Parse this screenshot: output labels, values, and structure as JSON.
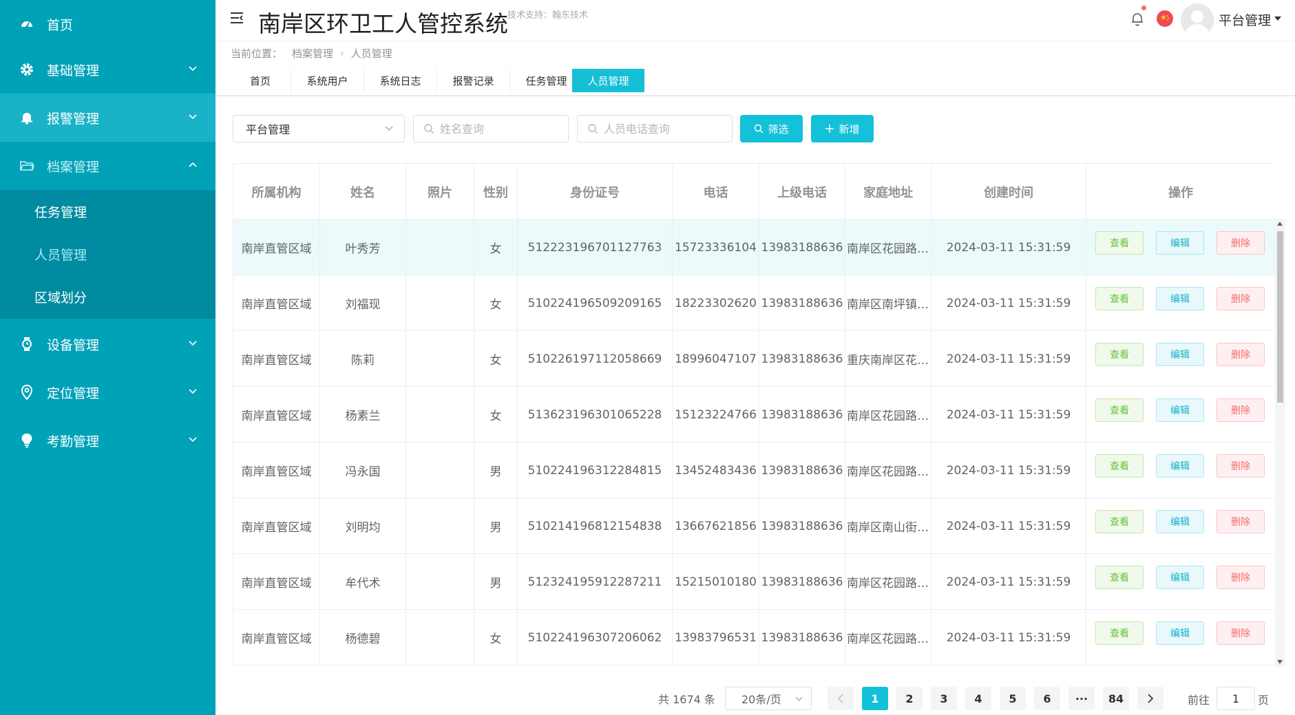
{
  "sidebar": {
    "items": [
      {
        "label": "首页",
        "icon": "dashboard-icon"
      },
      {
        "label": "基础管理",
        "icon": "gear-icon"
      },
      {
        "label": "报警管理",
        "icon": "bell-icon"
      },
      {
        "label": "档案管理",
        "icon": "folder-icon"
      },
      {
        "label": "设备管理",
        "icon": "watch-icon"
      },
      {
        "label": "定位管理",
        "icon": "location-icon"
      },
      {
        "label": "考勤管理",
        "icon": "bulb-icon"
      }
    ],
    "sub_items": [
      {
        "label": "任务管理"
      },
      {
        "label": "人员管理"
      },
      {
        "label": "区域划分"
      }
    ]
  },
  "header": {
    "title": "南岸区环卫工人管控系统",
    "tech_support": "技术支持：翰东技术",
    "user_name": "平台管理"
  },
  "breadcrumb": {
    "prefix": "当前位置：",
    "items": [
      "档案管理",
      "人员管理"
    ]
  },
  "tabs": [
    {
      "label": "首页"
    },
    {
      "label": "系统用户"
    },
    {
      "label": "系统日志"
    },
    {
      "label": "报警记录"
    },
    {
      "label": "任务管理"
    },
    {
      "label": "人员管理"
    }
  ],
  "filters": {
    "org_select": "平台管理",
    "name_placeholder": "姓名查询",
    "phone_placeholder": "人员电话查询",
    "filter_btn": "筛选",
    "add_btn": "新增"
  },
  "table": {
    "columns": [
      "所属机构",
      "姓名",
      "照片",
      "性别",
      "身份证号",
      "电话",
      "上级电话",
      "家庭地址",
      "创建时间",
      "操作"
    ],
    "op_labels": {
      "view": "查看",
      "edit": "编辑",
      "delete": "删除"
    },
    "rows": [
      {
        "org": "南岸直管区域",
        "name": "叶秀芳",
        "gender": "女",
        "id": "512223196701127763",
        "phone": "15723336104",
        "sup_phone": "13983188636",
        "addr": "南岸区花园路…",
        "created": "2024-03-11 15:31:59"
      },
      {
        "org": "南岸直管区域",
        "name": "刘福现",
        "gender": "女",
        "id": "510224196509209165",
        "phone": "18223302620",
        "sup_phone": "13983188636",
        "addr": "南岸区南坪镇…",
        "created": "2024-03-11 15:31:59"
      },
      {
        "org": "南岸直管区域",
        "name": "陈莉",
        "gender": "女",
        "id": "510226197112058669",
        "phone": "18996047107",
        "sup_phone": "13983188636",
        "addr": "重庆南岸区花…",
        "created": "2024-03-11 15:31:59"
      },
      {
        "org": "南岸直管区域",
        "name": "杨素兰",
        "gender": "女",
        "id": "513623196301065228",
        "phone": "15123224766",
        "sup_phone": "13983188636",
        "addr": "南岸区花园路…",
        "created": "2024-03-11 15:31:59"
      },
      {
        "org": "南岸直管区域",
        "name": "冯永国",
        "gender": "男",
        "id": "510224196312284815",
        "phone": "13452483436",
        "sup_phone": "13983188636",
        "addr": "南岸区花园路…",
        "created": "2024-03-11 15:31:59"
      },
      {
        "org": "南岸直管区域",
        "name": "刘明均",
        "gender": "男",
        "id": "510214196812154838",
        "phone": "13667621856",
        "sup_phone": "13983188636",
        "addr": "南岸区南山街…",
        "created": "2024-03-11 15:31:59"
      },
      {
        "org": "南岸直管区域",
        "name": "牟代术",
        "gender": "男",
        "id": "512324195912287211",
        "phone": "15215010180",
        "sup_phone": "13983188636",
        "addr": "南岸区花园路…",
        "created": "2024-03-11 15:31:59"
      },
      {
        "org": "南岸直管区域",
        "name": "杨德碧",
        "gender": "女",
        "id": "510224196307206062",
        "phone": "13983796531",
        "sup_phone": "13983188636",
        "addr": "南岸区花园路…",
        "created": "2024-03-11 15:31:59"
      }
    ]
  },
  "pagination": {
    "total": "共 1674 条",
    "page_size": "20条/页",
    "pages": [
      "1",
      "2",
      "3",
      "4",
      "5",
      "6",
      "···",
      "84"
    ],
    "goto_label": "前往",
    "goto_value": "1",
    "goto_suffix": "页"
  },
  "colors": {
    "sidebar_bg": "#00a2b8",
    "sidebar_sub_bg": "#008ba0",
    "accent": "#13c1d8",
    "view": "#67c23a",
    "delete": "#f56c6c"
  }
}
